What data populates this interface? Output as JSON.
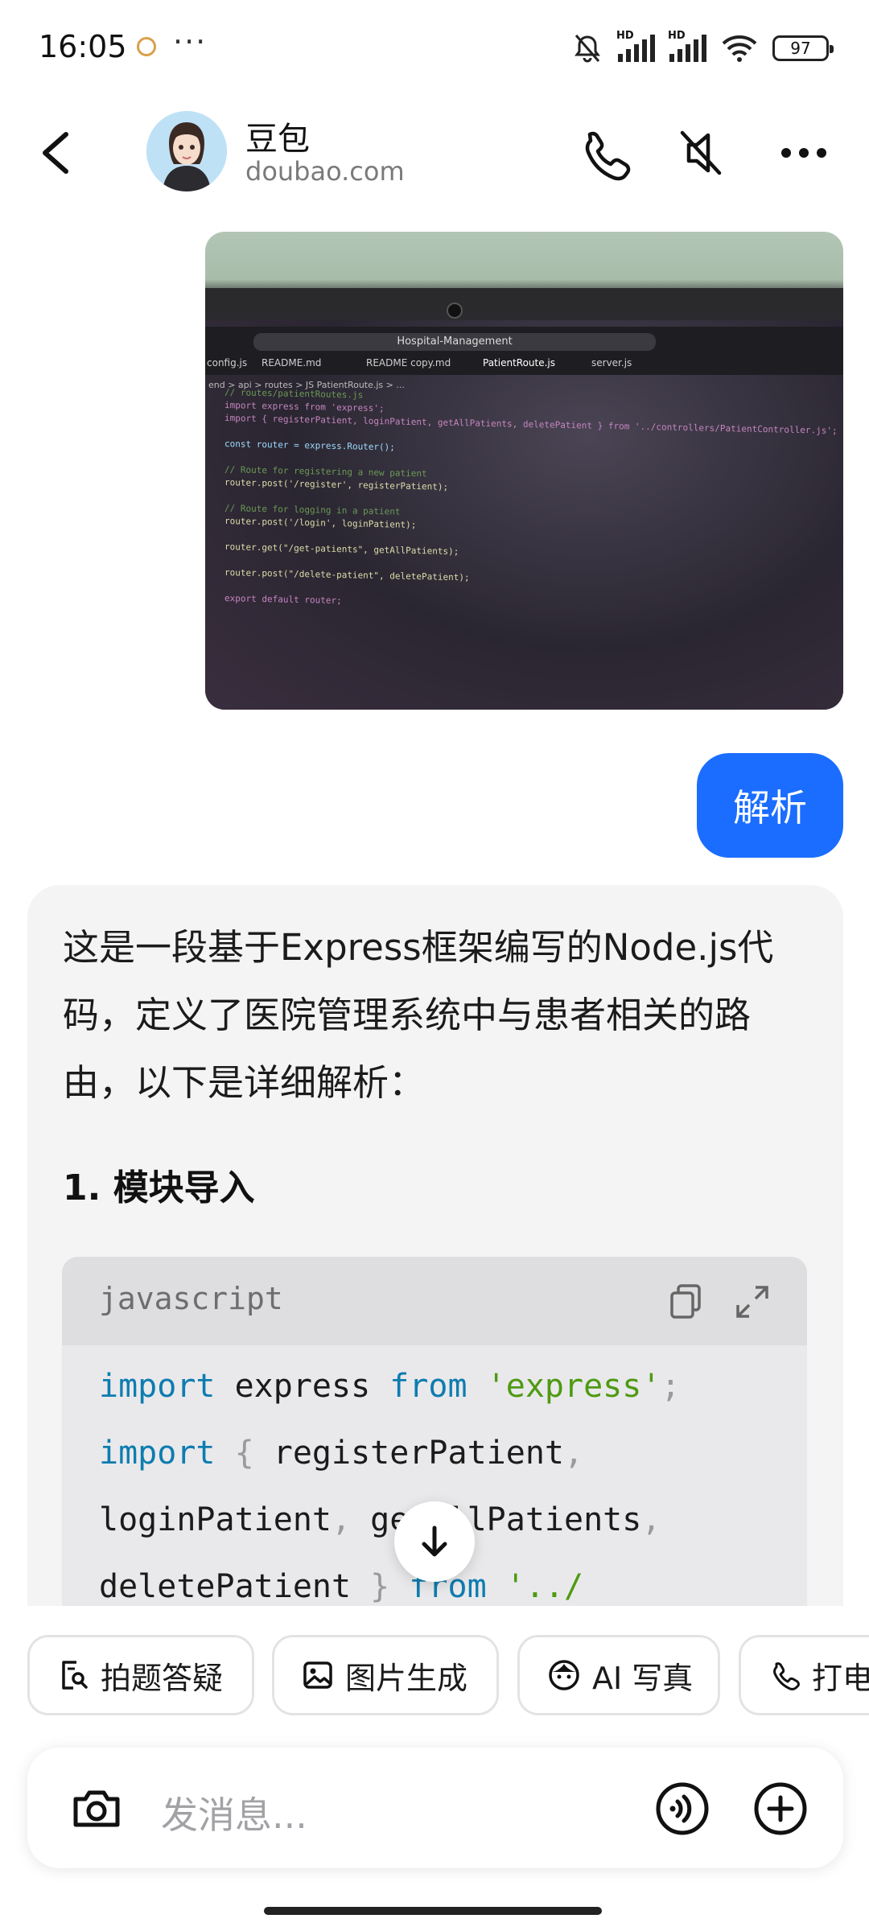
{
  "status_bar": {
    "time": "16:05",
    "dots": "···",
    "battery": "97",
    "signal_label_1": "HD",
    "signal_label_2": "HD"
  },
  "header": {
    "title": "豆包",
    "subtitle": "doubao.com"
  },
  "photo": {
    "address": "Hospital-Management",
    "tabs": [
      "config.js",
      "README.md",
      "README copy.md",
      "PatientRoute.js",
      "server.js"
    ],
    "breadcrumb": "end > api > routes > JS PatientRoute.js > ...",
    "code_lines": [
      "// routes/patientRoutes.js",
      "import express from 'express';",
      "import { registerPatient, loginPatient, getAllPatients, deletePatient } from '../controllers/PatientController.js';",
      "",
      "const router = express.Router();",
      "",
      "// Route for registering a new patient",
      "router.post('/register', registerPatient);",
      "",
      "// Route for logging in a patient",
      "router.post('/login', loginPatient);",
      "",
      "router.get(\"/get-patients\", getAllPatients);",
      "",
      "router.post(\"/delete-patient\", deletePatient);",
      "",
      "export default router;"
    ]
  },
  "user_message": "解析",
  "answer": {
    "intro": "这是一段基于Express框架编写的Node.js代码，定义了医院管理系统中与患者相关的路由，以下是详细解析：",
    "heading": "1. 模块导入",
    "code_lang": "javascript",
    "code_lines": {
      "l1_kw": "import",
      "l1_mid": " express ",
      "l1_kw2": "from",
      "l1_sp": " ",
      "l1_str": "'express'",
      "l1_end": ";",
      "l2_kw": "import",
      "l2_pn": " { ",
      "l2_id": "registerPatient",
      "l2_comma": ",",
      "l3_a": "loginPatient",
      "l3_c1": ",",
      "l3_b": " getAllPatients",
      "l3_c2": ",",
      "l4_a": "deletePatient",
      "l4_pn": " } ",
      "l4_kw": "from",
      "l4_sp": " ",
      "l4_str": "'../"
    }
  },
  "quick_actions": [
    {
      "label": "拍题答疑",
      "icon": "search-doc-icon"
    },
    {
      "label": "图片生成",
      "icon": "image-icon"
    },
    {
      "label": "AI 写真",
      "icon": "face-icon"
    },
    {
      "label": "打电话",
      "icon": "phone-icon"
    }
  ],
  "input": {
    "placeholder": "发消息..."
  },
  "colors": {
    "accent": "#1a6dff",
    "card_bg": "#f4f4f5",
    "code_keyword": "#0e7cb0",
    "code_string": "#4f9a12"
  }
}
